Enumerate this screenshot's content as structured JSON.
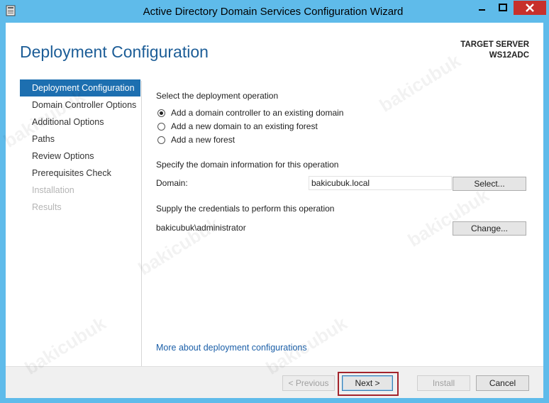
{
  "window": {
    "title": "Active Directory Domain Services Configuration Wizard",
    "app_icon": "server-manager-icon",
    "controls": {
      "minimize": "minimize-icon",
      "maximize": "maximize-icon",
      "close": "close-icon"
    }
  },
  "header": {
    "page_title": "Deployment Configuration",
    "target_label": "TARGET SERVER",
    "target_server": "WS12ADC"
  },
  "nav": {
    "items": [
      {
        "label": "Deployment Configuration",
        "state": "active"
      },
      {
        "label": "Domain Controller Options",
        "state": "normal"
      },
      {
        "label": "Additional Options",
        "state": "normal"
      },
      {
        "label": "Paths",
        "state": "normal"
      },
      {
        "label": "Review Options",
        "state": "normal"
      },
      {
        "label": "Prerequisites Check",
        "state": "normal"
      },
      {
        "label": "Installation",
        "state": "disabled"
      },
      {
        "label": "Results",
        "state": "disabled"
      }
    ]
  },
  "main": {
    "operation_heading": "Select the deployment operation",
    "options": [
      {
        "label": "Add a domain controller to an existing domain",
        "checked": true
      },
      {
        "label": "Add a new domain to an existing forest",
        "checked": false
      },
      {
        "label": "Add a new forest",
        "checked": false
      }
    ],
    "domain_heading": "Specify the domain information for this operation",
    "domain_label": "Domain:",
    "domain_value": "bakicubuk.local",
    "select_button": "Select...",
    "credentials_heading": "Supply the credentials to perform this operation",
    "credentials_user": "bakicubuk\\administrator",
    "change_button": "Change...",
    "more_link": "More about deployment configurations"
  },
  "footer": {
    "previous": "< Previous",
    "next": "Next >",
    "install": "Install",
    "cancel": "Cancel"
  },
  "watermark": {
    "text": "bakicubuk"
  },
  "colors": {
    "titlebar": "#5fbbea",
    "close_button": "#c7302b",
    "accent": "#1d6fb0",
    "title_text": "#1c5d97",
    "link": "#1b5fa8",
    "highlight": "#a3242c"
  }
}
